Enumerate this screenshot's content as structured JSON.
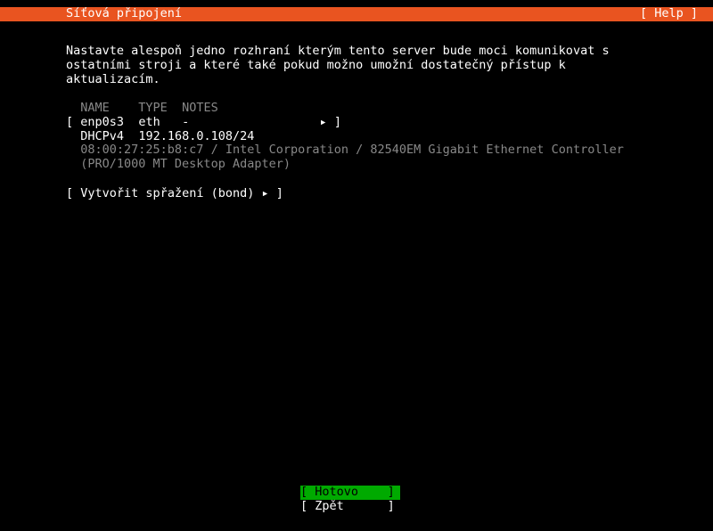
{
  "header": {
    "title": "Síťová připojení",
    "help": "[ Help ]"
  },
  "instructions": {
    "line1": "Nastavte alespoň jedno rozhraní kterým tento server bude moci komunikovat s",
    "line2": "ostatními stroji a které také pokud možno umožní dostatečný přístup k",
    "line3": "aktualizacím."
  },
  "table": {
    "headers": {
      "name": "NAME",
      "type": "TYPE",
      "notes": "NOTES"
    },
    "row1": {
      "lb": "[",
      "name": "enp0s3",
      "type": "eth",
      "notes": "-",
      "arrow": "▸",
      "rb": "]"
    },
    "row2": {
      "method": "DHCPv4",
      "addr": "192.168.0.108/24"
    },
    "mac1": "08:00:27:25:b8:c7 / Intel Corporation / 82540EM Gigabit Ethernet Controller",
    "mac2": "(PRO/1000 MT Desktop Adapter)"
  },
  "bond": {
    "lb": "[",
    "label": "Vytvořit spřažení (bond)",
    "arrow": "▸",
    "rb": "]"
  },
  "footer": {
    "done": {
      "lb": "[ ",
      "label": "Hotovo",
      "pad": "    ",
      "rb": "]"
    },
    "back": {
      "lb": "[ ",
      "label": "Zpět",
      "pad": "      ",
      "rb": "]"
    }
  }
}
